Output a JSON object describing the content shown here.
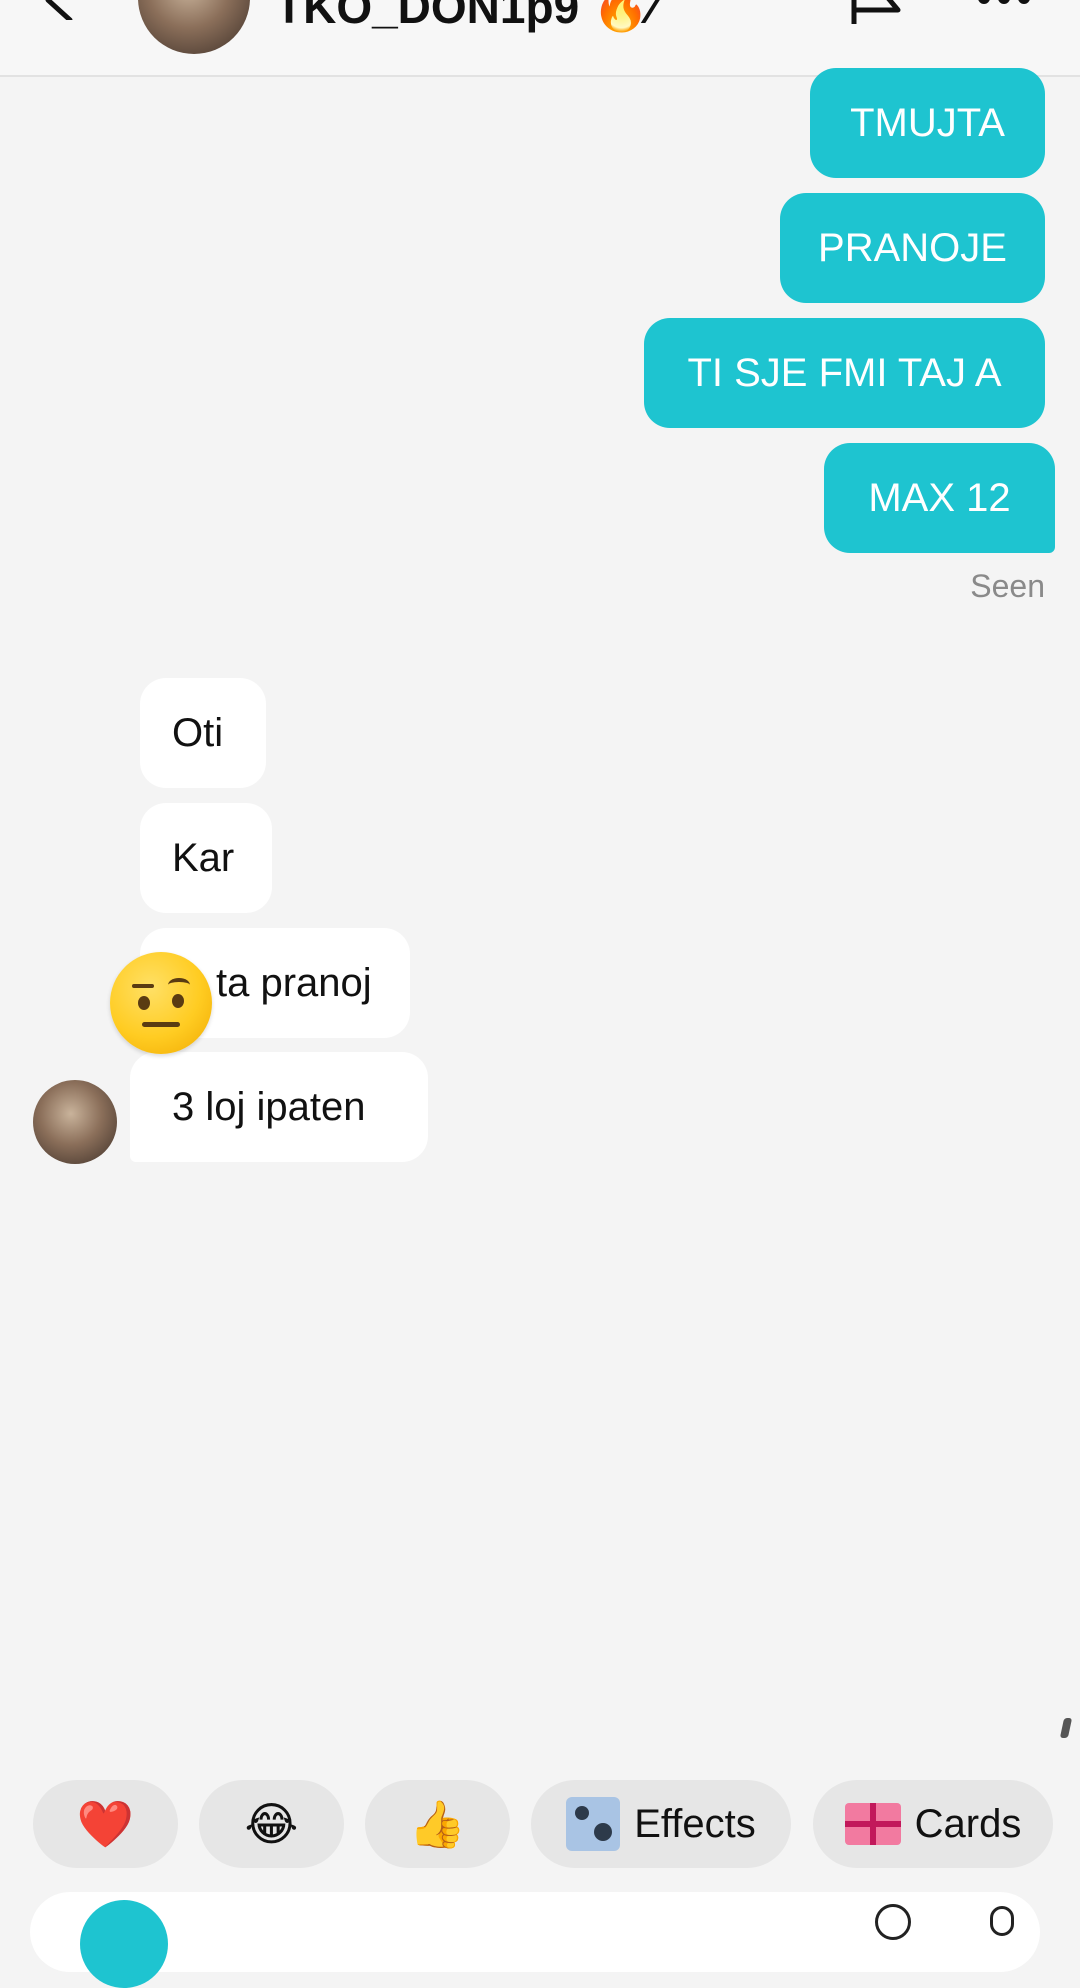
{
  "header": {
    "title": "TKO_DON1p9 🔥⁄",
    "back_icon": "chevron-left-icon",
    "flag_icon": "flag-icon",
    "more_icon": "more-dots-icon"
  },
  "messages": {
    "sent": [
      {
        "text": "TMUJTA"
      },
      {
        "text": "PRANOJE"
      },
      {
        "text": "TI SJE FMI TAJ A"
      },
      {
        "text": "MAX 12"
      }
    ],
    "status": "Seen",
    "received": [
      {
        "text": "Oti"
      },
      {
        "text": "Kar"
      },
      {
        "text": "ta pranoj"
      },
      {
        "text": "3 loj ipaten"
      }
    ],
    "reaction_emoji": "🤨"
  },
  "quick_actions": {
    "heart": "❤️",
    "laugh": "😂",
    "thumbs_up": "👍",
    "effects_label": "Effects",
    "cards_label": "Cards"
  },
  "colors": {
    "sent_bubble": "#1ec4d0",
    "received_bubble": "#ffffff",
    "background": "#f4f4f4",
    "chip_background": "#e6e6e6"
  }
}
